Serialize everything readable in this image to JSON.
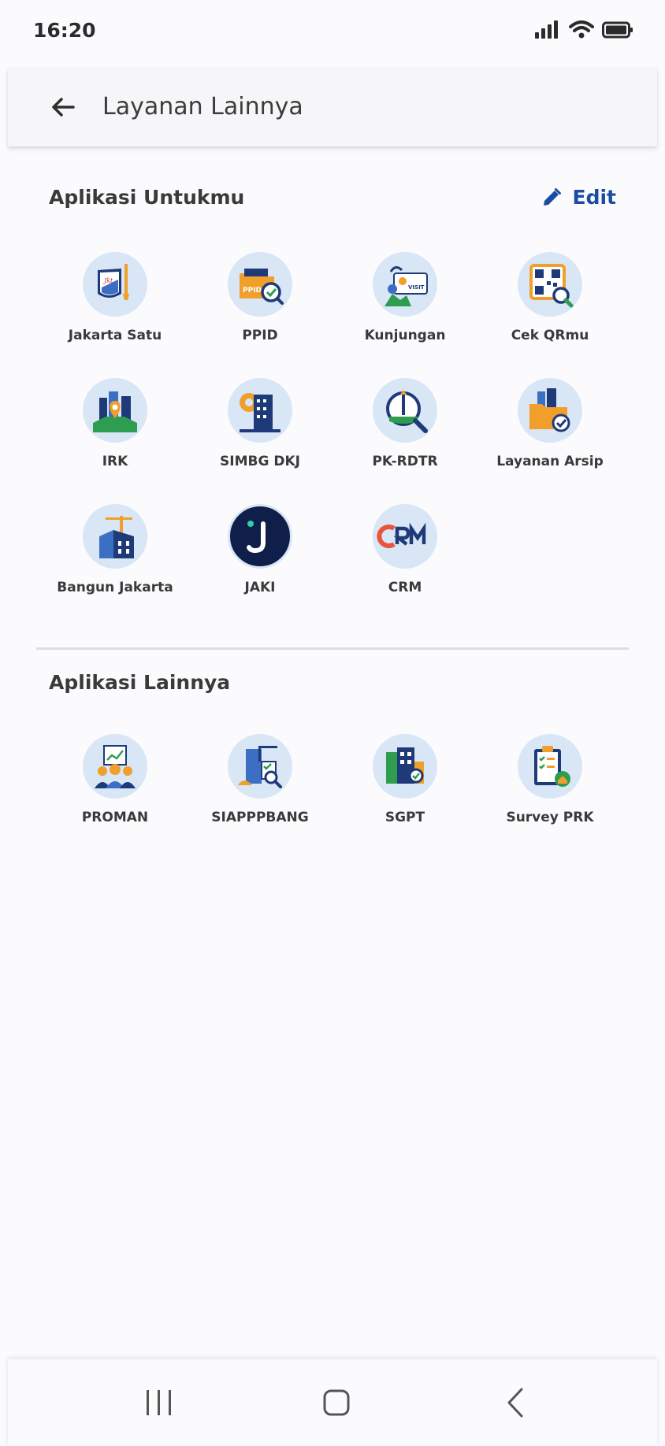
{
  "status_bar": {
    "time": "16:20",
    "icons": [
      "signal-icon",
      "wifi-icon",
      "battery-icon"
    ]
  },
  "header": {
    "back_icon": "arrow-left-icon",
    "title": "Layanan Lainnya"
  },
  "sections": {
    "favorites": {
      "title": "Aplikasi Untukmu",
      "edit_label": "Edit",
      "edit_icon": "pencil-icon",
      "apps": [
        {
          "label": "Jakarta Satu",
          "icon": "jakarta-satu-icon"
        },
        {
          "label": "PPID",
          "icon": "ppid-folder-icon"
        },
        {
          "label": "Kunjungan",
          "icon": "visitor-card-icon"
        },
        {
          "label": "Cek QRmu",
          "icon": "qr-code-icon"
        },
        {
          "label": "IRK",
          "icon": "city-map-pin-icon"
        },
        {
          "label": "SIMBG DKJ",
          "icon": "building-gear-icon"
        },
        {
          "label": "PK-RDTR",
          "icon": "monument-magnifier-icon"
        },
        {
          "label": "Layanan Arsip",
          "icon": "archive-folder-icon"
        },
        {
          "label": "Bangun Jakarta",
          "icon": "construction-crane-icon"
        },
        {
          "label": "JAKI",
          "icon": "jaki-logo-icon"
        },
        {
          "label": "CRM",
          "icon": "crm-logo-icon"
        }
      ]
    },
    "others": {
      "title": "Aplikasi Lainnya",
      "apps": [
        {
          "label": "PROMAN",
          "icon": "team-chart-icon"
        },
        {
          "label": "SIAPPPBANG",
          "icon": "building-inspection-icon"
        },
        {
          "label": "SGPT",
          "icon": "building-check-icon"
        },
        {
          "label": "Survey PRK",
          "icon": "clipboard-checklist-icon"
        }
      ]
    }
  },
  "nav_bar": {
    "items": [
      "recent-apps-icon",
      "home-icon",
      "back-icon"
    ]
  },
  "colors": {
    "accent": "#1a4da1",
    "icon_bg": "#d8e6f6",
    "navy": "#1f3a78",
    "orange": "#f0a02a"
  }
}
